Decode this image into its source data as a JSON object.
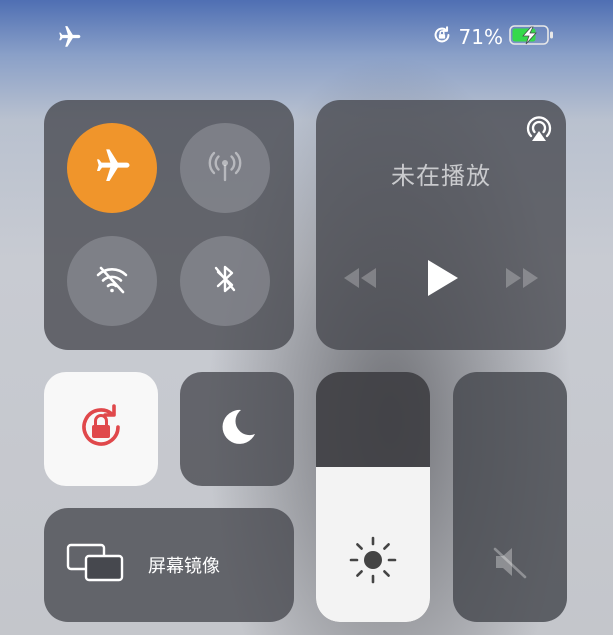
{
  "status_bar": {
    "airplane_icon": "airplane-icon",
    "orientation_lock_icon": "orientation-lock-icon",
    "battery_percent": "71%",
    "battery_color": "#35d94a"
  },
  "connectivity": {
    "airplane_mode": {
      "icon": "airplane-icon",
      "active": true,
      "color": "#f0952b"
    },
    "cellular": {
      "icon": "antenna-icon",
      "active": false
    },
    "wifi": {
      "icon": "wifi-off-icon",
      "active": false
    },
    "bluetooth": {
      "icon": "bluetooth-off-icon",
      "active": false
    }
  },
  "media": {
    "title": "未在播放",
    "airplay_icon": "airplay-icon",
    "controls": [
      "rewind-icon",
      "play-icon",
      "fast-forward-icon"
    ]
  },
  "orientation_lock": {
    "icon": "lock-rotation-icon",
    "active": true,
    "color": "#e0484b"
  },
  "do_not_disturb": {
    "icon": "moon-icon",
    "active": false
  },
  "screen_mirroring": {
    "label": "屏幕镜像",
    "icon": "screen-mirroring-icon"
  },
  "brightness": {
    "icon": "sun-icon",
    "level": 0.62
  },
  "volume": {
    "icon": "speaker-muted-icon",
    "level": 0.0
  }
}
